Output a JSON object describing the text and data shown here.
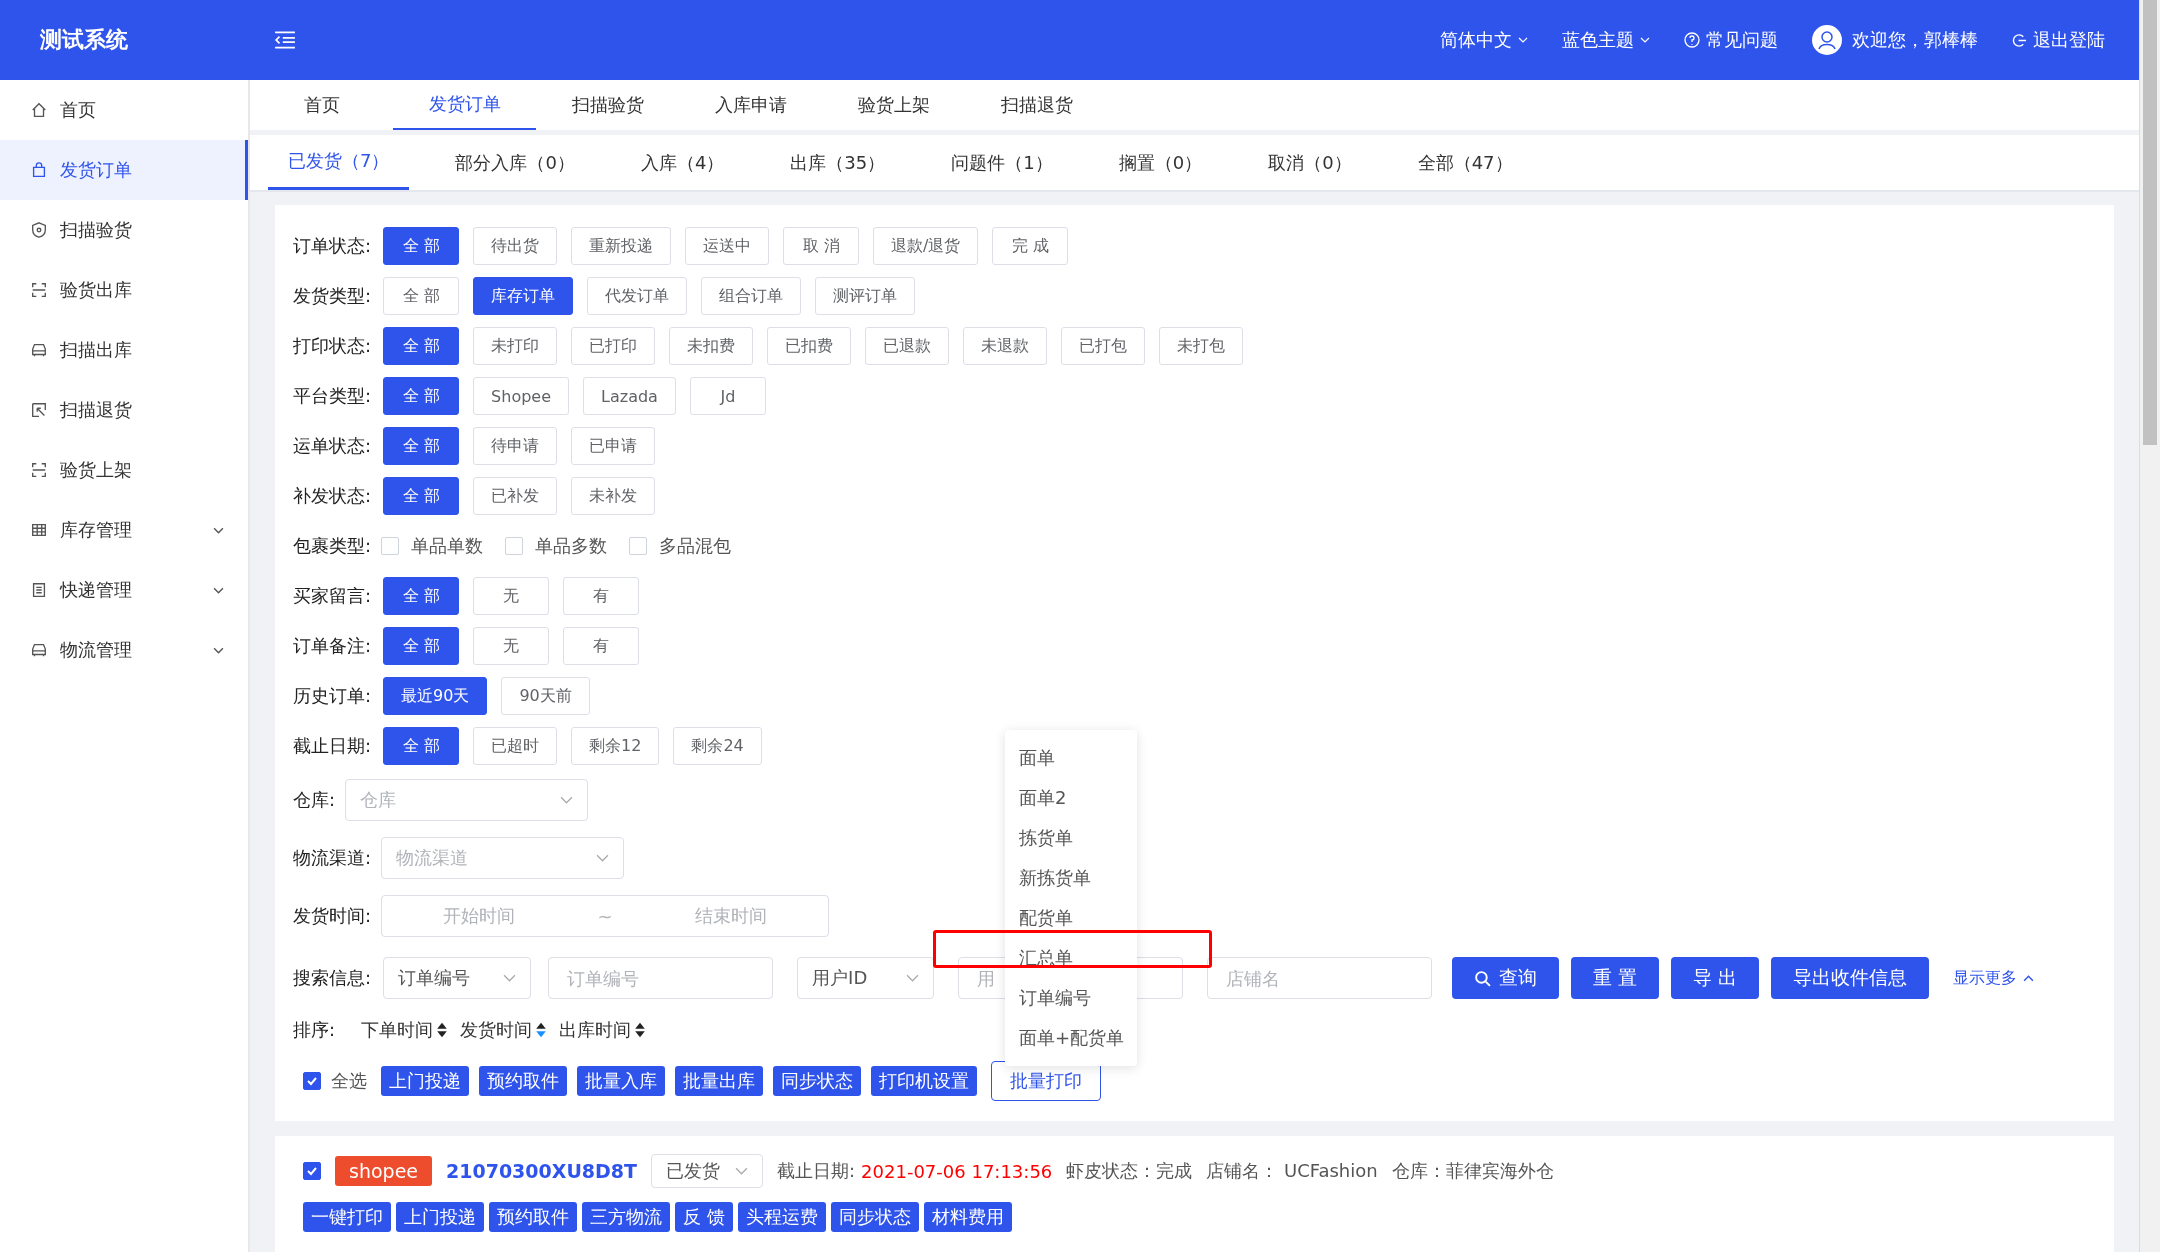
{
  "header": {
    "logo": "测试系统",
    "language": "简体中文",
    "theme": "蓝色主题",
    "help": "常见问题",
    "welcome": "欢迎您，郭棒棒",
    "logout": "退出登陆"
  },
  "sidebar": {
    "items": [
      {
        "label": "首页",
        "selected": false,
        "expandable": false
      },
      {
        "label": "发货订单",
        "selected": true,
        "expandable": false
      },
      {
        "label": "扫描验货",
        "selected": false,
        "expandable": false
      },
      {
        "label": "验货出库",
        "selected": false,
        "expandable": false
      },
      {
        "label": "扫描出库",
        "selected": false,
        "expandable": false
      },
      {
        "label": "扫描退货",
        "selected": false,
        "expandable": false
      },
      {
        "label": "验货上架",
        "selected": false,
        "expandable": false
      },
      {
        "label": "库存管理",
        "selected": false,
        "expandable": true
      },
      {
        "label": "快递管理",
        "selected": false,
        "expandable": true
      },
      {
        "label": "物流管理",
        "selected": false,
        "expandable": true
      }
    ]
  },
  "tabs": [
    {
      "label": "首页",
      "selected": false
    },
    {
      "label": "发货订单",
      "selected": true
    },
    {
      "label": "扫描验货",
      "selected": false
    },
    {
      "label": "入库申请",
      "selected": false
    },
    {
      "label": "验货上架",
      "selected": false
    },
    {
      "label": "扫描退货",
      "selected": false
    }
  ],
  "sub_tabs": [
    {
      "label": "已发货（7）",
      "selected": true
    },
    {
      "label": "部分入库（0）",
      "selected": false
    },
    {
      "label": "入库（4）",
      "selected": false
    },
    {
      "label": "出库（35）",
      "selected": false
    },
    {
      "label": "问题件（1）",
      "selected": false
    },
    {
      "label": "搁置（0）",
      "selected": false
    },
    {
      "label": "取消（0）",
      "selected": false
    },
    {
      "label": "全部（47）",
      "selected": false
    }
  ],
  "filters": [
    {
      "kind": "buttons",
      "label": "订单状态:",
      "options": [
        {
          "label": "全 部",
          "selected": true
        },
        {
          "label": "待出货",
          "selected": false
        },
        {
          "label": "重新投递",
          "selected": false
        },
        {
          "label": "运送中",
          "selected": false
        },
        {
          "label": "取 消",
          "selected": false
        },
        {
          "label": "退款/退货",
          "selected": false
        },
        {
          "label": "完 成",
          "selected": false
        }
      ]
    },
    {
      "kind": "buttons",
      "label": "发货类型:",
      "options": [
        {
          "label": "全 部",
          "selected": false
        },
        {
          "label": "库存订单",
          "selected": true
        },
        {
          "label": "代发订单",
          "selected": false
        },
        {
          "label": "组合订单",
          "selected": false
        },
        {
          "label": "测评订单",
          "selected": false
        }
      ]
    },
    {
      "kind": "buttons",
      "label": "打印状态:",
      "options": [
        {
          "label": "全 部",
          "selected": true
        },
        {
          "label": "未打印",
          "selected": false
        },
        {
          "label": "已打印",
          "selected": false
        },
        {
          "label": "未扣费",
          "selected": false
        },
        {
          "label": "已扣费",
          "selected": false
        },
        {
          "label": "已退款",
          "selected": false
        },
        {
          "label": "未退款",
          "selected": false
        },
        {
          "label": "已打包",
          "selected": false
        },
        {
          "label": "未打包",
          "selected": false
        }
      ]
    },
    {
      "kind": "buttons",
      "label": "平台类型:",
      "options": [
        {
          "label": "全 部",
          "selected": true
        },
        {
          "label": "Shopee",
          "selected": false
        },
        {
          "label": "Lazada",
          "selected": false
        },
        {
          "label": "Jd",
          "selected": false
        }
      ]
    },
    {
      "kind": "buttons",
      "label": "运单状态:",
      "options": [
        {
          "label": "全 部",
          "selected": true
        },
        {
          "label": "待申请",
          "selected": false
        },
        {
          "label": "已申请",
          "selected": false
        }
      ]
    },
    {
      "kind": "buttons",
      "label": "补发状态:",
      "options": [
        {
          "label": "全 部",
          "selected": true
        },
        {
          "label": "已补发",
          "selected": false
        },
        {
          "label": "未补发",
          "selected": false
        }
      ]
    },
    {
      "kind": "checkboxes",
      "label": "包裹类型:",
      "options": [
        {
          "label": "单品单数",
          "checked": false
        },
        {
          "label": "单品多数",
          "checked": false
        },
        {
          "label": "多品混包",
          "checked": false
        }
      ]
    },
    {
      "kind": "buttons",
      "label": "买家留言:",
      "options": [
        {
          "label": "全 部",
          "selected": true
        },
        {
          "label": "无",
          "selected": false
        },
        {
          "label": "有",
          "selected": false
        }
      ]
    },
    {
      "kind": "buttons",
      "label": "订单备注:",
      "options": [
        {
          "label": "全 部",
          "selected": true
        },
        {
          "label": "无",
          "selected": false
        },
        {
          "label": "有",
          "selected": false
        }
      ]
    },
    {
      "kind": "buttons",
      "label": "历史订单:",
      "options": [
        {
          "label": "最近90天",
          "selected": true
        },
        {
          "label": "90天前",
          "selected": false
        }
      ]
    },
    {
      "kind": "buttons",
      "label": "截止日期:",
      "options": [
        {
          "label": "全 部",
          "selected": true
        },
        {
          "label": "已超时",
          "selected": false
        },
        {
          "label": "剩余12",
          "selected": false
        },
        {
          "label": "剩余24",
          "selected": false
        }
      ]
    },
    {
      "kind": "select",
      "label": "仓库:",
      "placeholder": "仓库"
    },
    {
      "kind": "select",
      "label": "物流渠道:",
      "placeholder": "物流渠道"
    },
    {
      "kind": "date_range",
      "label": "发货时间:",
      "start_placeholder": "开始时间",
      "separator": "~",
      "end_placeholder": "结束时间"
    }
  ],
  "search": {
    "label": "搜索信息:",
    "field_select": "订单编号",
    "field_placeholder": "订单编号",
    "user_select": "用户ID",
    "user_placeholder": "用",
    "shop_placeholder": "店铺名",
    "buttons": [
      "查询",
      "重 置",
      "导 出",
      "导出收件信息"
    ],
    "show_more": "显示更多"
  },
  "sort": {
    "label": "排序:",
    "options": [
      {
        "label": "下单时间",
        "descending": false
      },
      {
        "label": "发货时间",
        "descending": true
      },
      {
        "label": "出库时间",
        "descending": false
      }
    ]
  },
  "batch": {
    "select_all": {
      "label": "全选",
      "checked": true
    },
    "actions": [
      "上门投递",
      "预约取件",
      "批量入库",
      "批量出库",
      "同步状态",
      "打印机设置"
    ],
    "print_button": "批量打印"
  },
  "print_menu": {
    "items": [
      {
        "label": "面单",
        "highlighted": false
      },
      {
        "label": "面单2",
        "highlighted": false
      },
      {
        "label": "拣货单",
        "highlighted": false
      },
      {
        "label": "新拣货单",
        "highlighted": false
      },
      {
        "label": "配货单",
        "highlighted": false
      },
      {
        "label": "汇总单",
        "highlighted": true
      },
      {
        "label": "订单编号",
        "highlighted": false
      },
      {
        "label": "面单+配货单",
        "highlighted": false
      }
    ]
  },
  "order": {
    "checked": true,
    "platform": "shopee",
    "number": "21070300XU8D8T",
    "status": "已发货",
    "deadline_label": "截止日期:",
    "deadline": "2021-07-06 17:13:56",
    "shopee_status": "虾皮状态：完成",
    "shop": "店铺名：  UCFashion",
    "warehouse": "仓库：菲律宾海外仓",
    "actions": [
      "一键打印",
      "上门投递",
      "预约取件",
      "三方物流",
      "反 馈",
      "头程运费",
      "同步状态",
      "材料费用"
    ]
  }
}
